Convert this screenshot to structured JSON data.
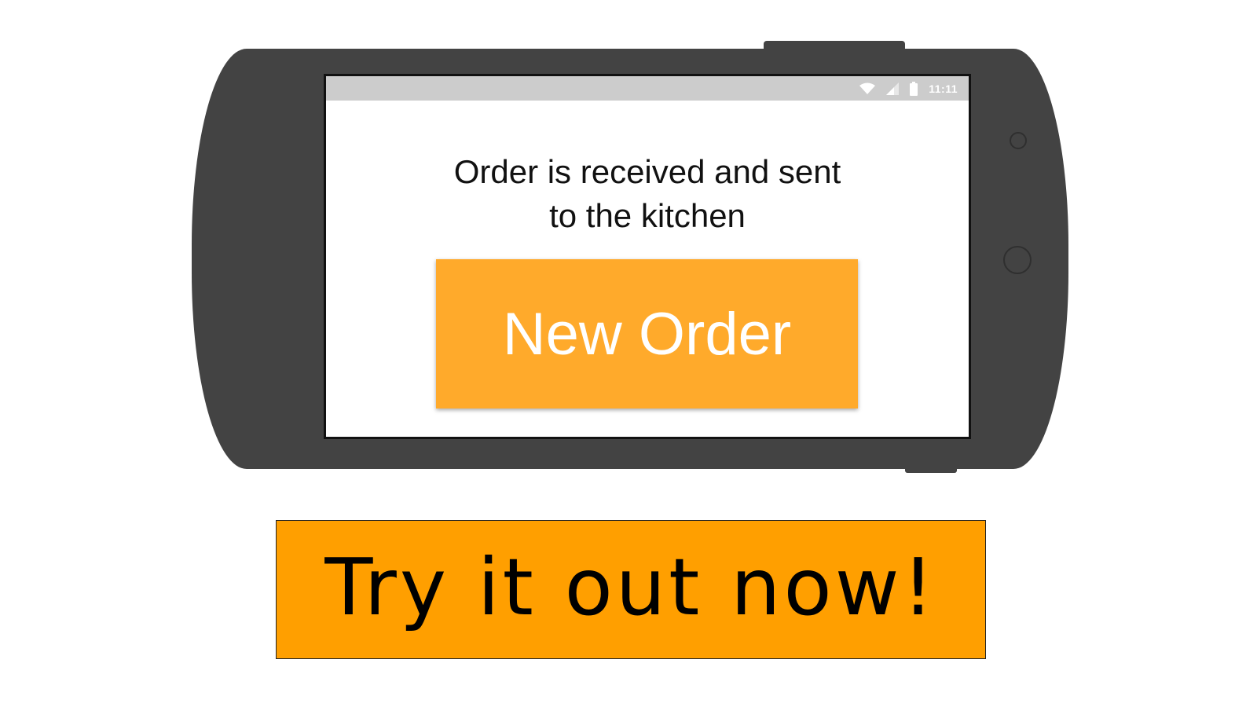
{
  "colors": {
    "phone_body": "#434343",
    "status_bar": "#cccccc",
    "new_order_button": "#ffaa2b",
    "cta_button": "#ff9f00"
  },
  "status_bar": {
    "icons": [
      "wifi-icon",
      "cell-signal-icon",
      "battery-icon"
    ],
    "time": "11:11"
  },
  "screen": {
    "message_line1": "Order is received and sent",
    "message_line2": "to the kitchen",
    "new_order_label": "New Order"
  },
  "cta": {
    "label": "Try it out now!"
  }
}
